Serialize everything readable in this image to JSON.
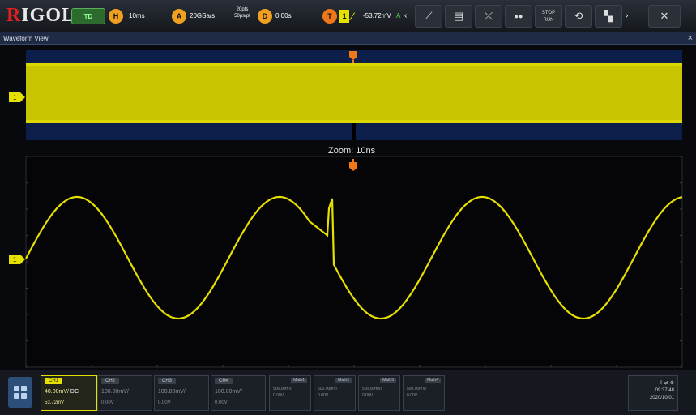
{
  "brand": {
    "logo_text": "RIGOL"
  },
  "top_bar": {
    "trigger_mode": "TD",
    "horizontal": {
      "badge": "H",
      "timebase": "10ms"
    },
    "acquisition": {
      "badge": "A",
      "sample_rate": "20GSa/s",
      "memory_line1": "20pts",
      "memory_line2": "50ps/pt"
    },
    "delay": {
      "badge": "D",
      "value": "0.00s"
    },
    "trigger": {
      "badge": "T",
      "source": "1",
      "level": "-53.72mV",
      "mode": "A"
    },
    "buttons": [
      {
        "name": "ruler-icon",
        "glyph": "⟋"
      },
      {
        "name": "measure-icon",
        "glyph": "▤"
      },
      {
        "name": "xy-icon",
        "glyph": "⤫"
      },
      {
        "name": "dots-icon",
        "glyph": "●●"
      },
      {
        "name": "run-stop-icon",
        "label1": "STOP",
        "label2": "RUN"
      },
      {
        "name": "history-icon",
        "glyph": "⟲"
      },
      {
        "name": "apps-icon",
        "glyph": "▚"
      },
      {
        "name": "clear-icon",
        "glyph": "✕"
      }
    ]
  },
  "window": {
    "title": "Waveform View",
    "close": "×"
  },
  "main_view": {
    "zoom_label": "Zoom: 10ns",
    "channel_marker": "1"
  },
  "colors": {
    "ch1": "#e6e000",
    "trigger": "#f07818",
    "overview_bg": "#0c1f4a"
  },
  "bottom_bar": {
    "channels": [
      {
        "name": "CH1",
        "scale": "40.00mV/",
        "coupling": "DC",
        "offset": "53.72mV",
        "active": true
      },
      {
        "name": "CH2",
        "scale": "100.00mV/",
        "offset": "0.00V",
        "active": false
      },
      {
        "name": "CH3",
        "scale": "100.00mV/",
        "offset": "0.00V",
        "active": false
      },
      {
        "name": "CH4",
        "scale": "100.00mV/",
        "offset": "0.00V",
        "active": false
      }
    ],
    "math": [
      {
        "name": "Math1",
        "scale": "500.00mV/",
        "offset": "0.00V"
      },
      {
        "name": "Math2",
        "scale": "500.00mV/",
        "offset": "0.00V"
      },
      {
        "name": "Math3",
        "scale": "500.00mV/",
        "offset": "0.00V"
      },
      {
        "name": "Math4",
        "scale": "500.00mV/",
        "offset": "0.00V"
      }
    ],
    "status": {
      "time": "09:37:48",
      "date": "2020/10/01"
    }
  }
}
